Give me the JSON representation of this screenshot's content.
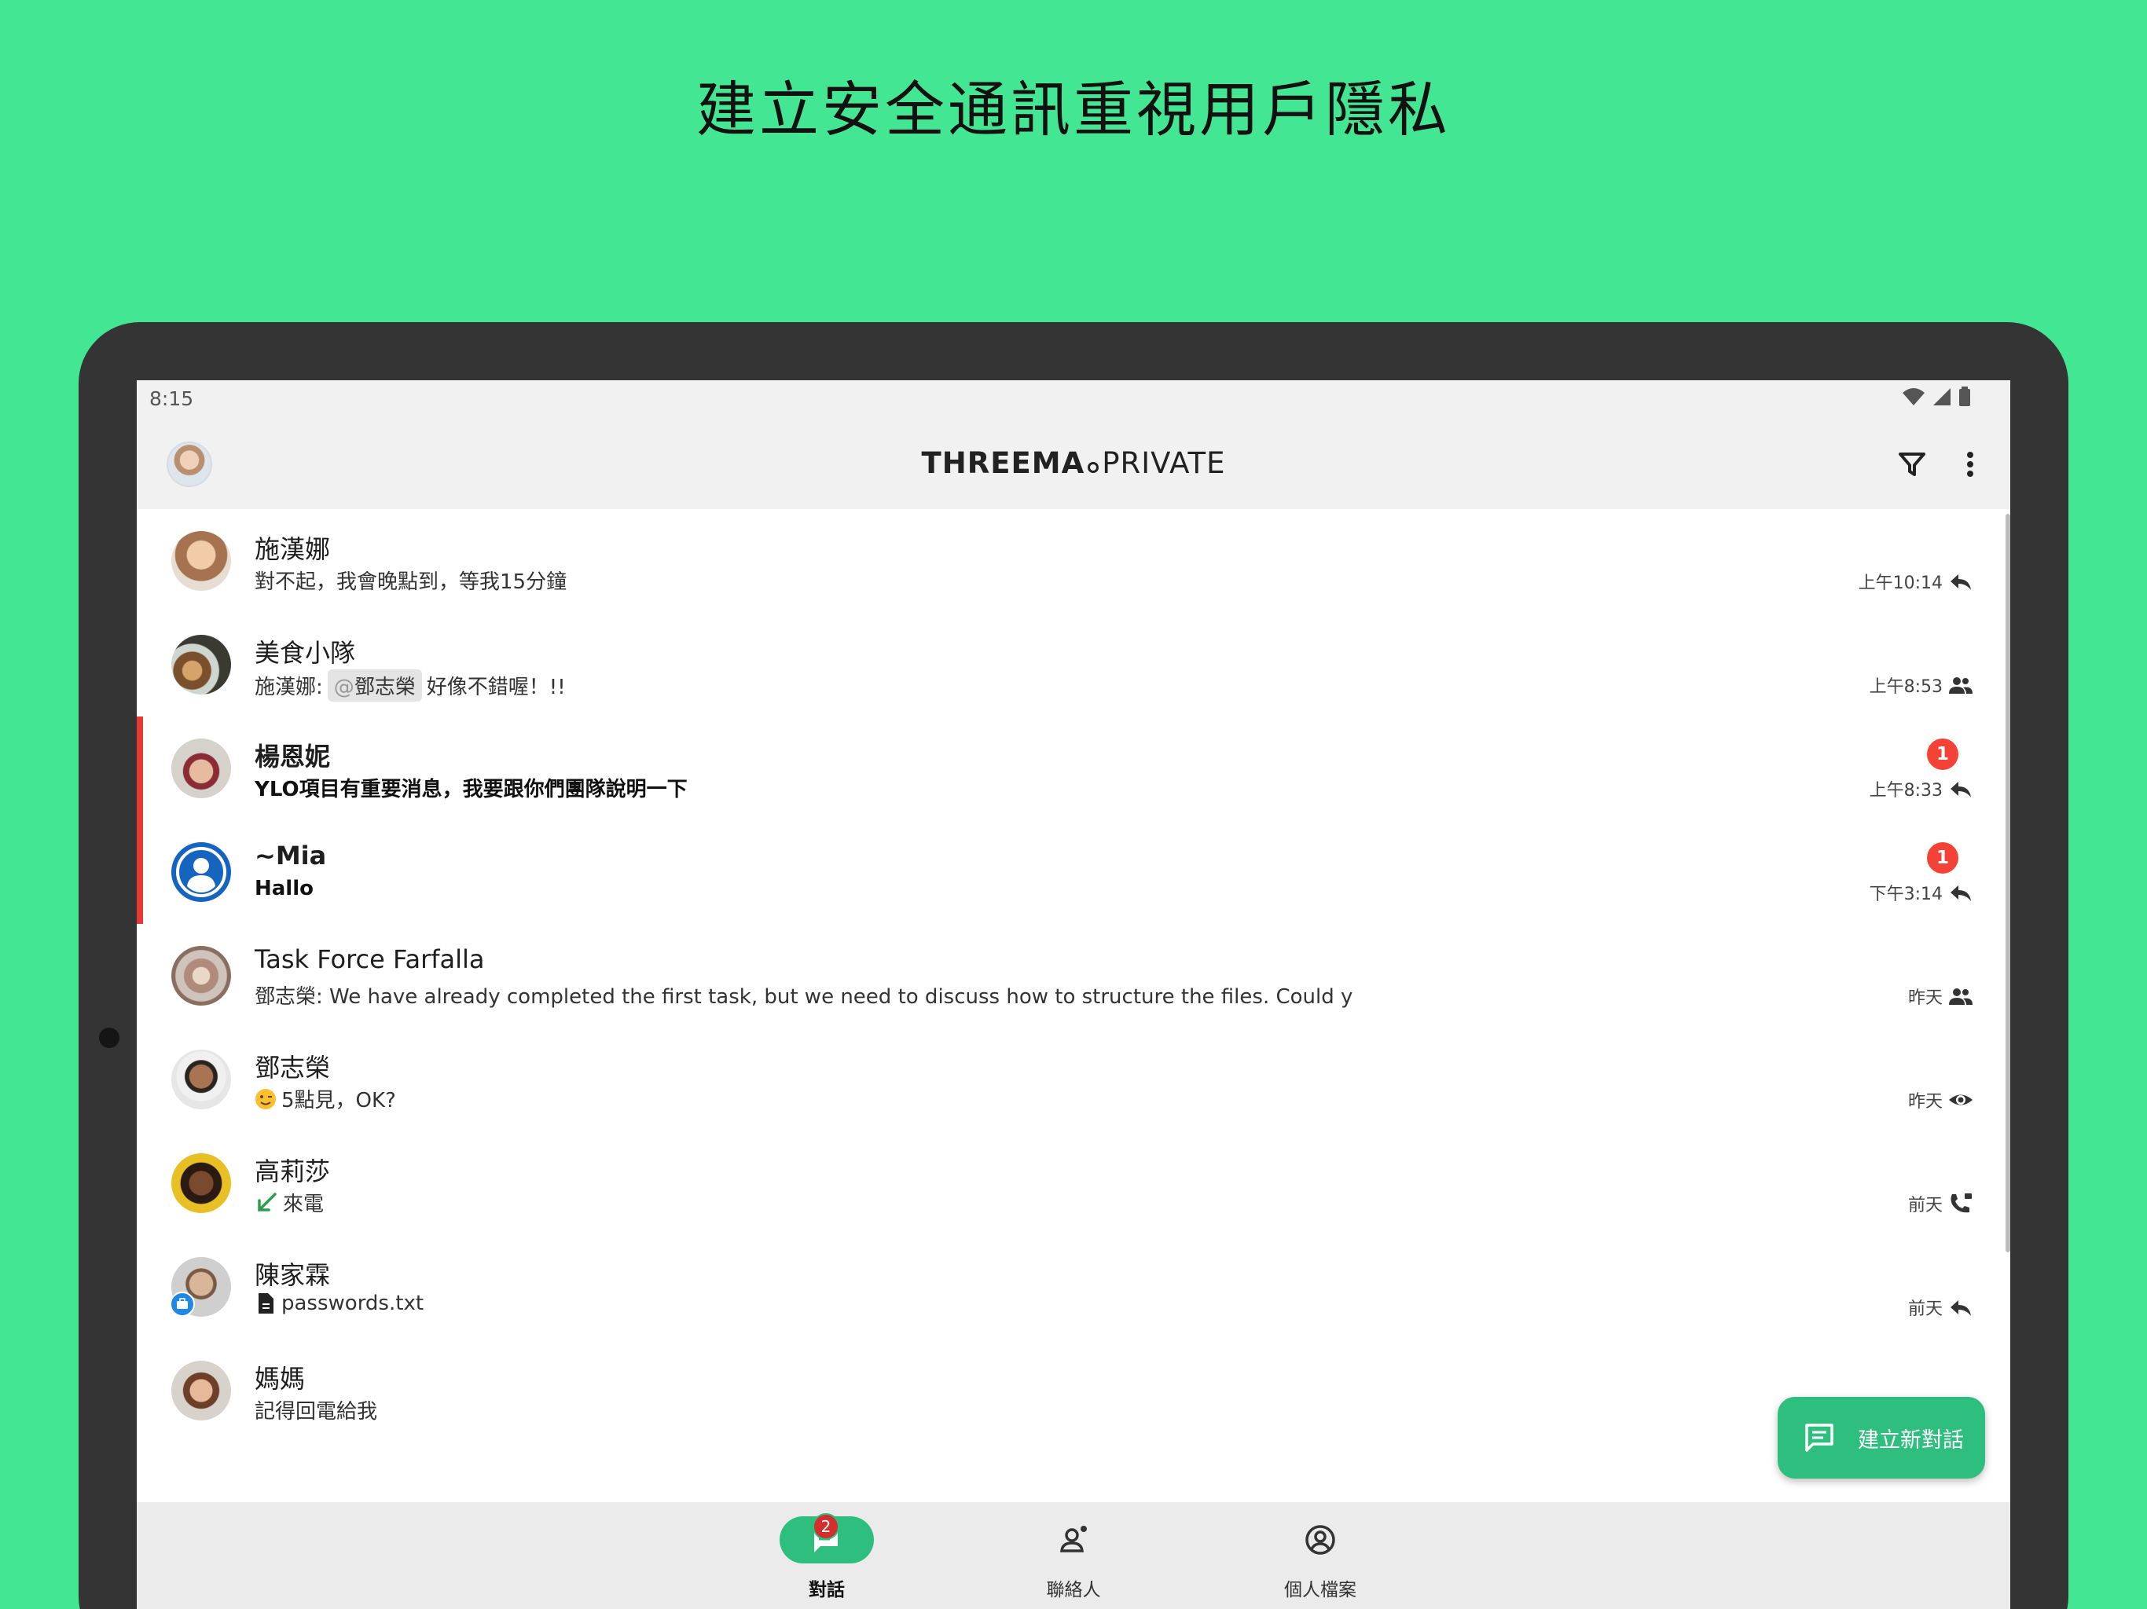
{
  "headline": "建立安全通訊重視用戶隱私",
  "status": {
    "time": "8:15"
  },
  "appbar": {
    "brand_bold": "THREEMA",
    "brand_thin": "PRIVATE"
  },
  "colors": {
    "accent": "#2ebf7f",
    "background": "#43e692",
    "unread_flag": "#e53935",
    "badge": "#f44336"
  },
  "conversations": [
    {
      "name": "施漢娜",
      "preview": "對不起，我會晚點到，等我15分鐘",
      "time": "上午10:14",
      "status_icon": "reply-icon",
      "unread": 0
    },
    {
      "name": "美食小隊",
      "preview_prefix": "施漢娜:",
      "mention_at": "@",
      "mention": "鄧志榮",
      "preview_suffix": "好像不錯喔！!!",
      "time": "上午8:53",
      "status_icon": "group-icon",
      "unread": 0
    },
    {
      "name": "楊恩妮",
      "preview": "YLO項目有重要消息，我要跟你們團隊說明一下",
      "time": "上午8:33",
      "status_icon": "reply-icon",
      "unread": 1,
      "unread_label": "1"
    },
    {
      "name": "~Mia",
      "preview": "Hallo",
      "time": "下午3:14",
      "status_icon": "reply-icon",
      "unread": 1,
      "unread_label": "1"
    },
    {
      "name": "Task Force Farfalla",
      "preview": "鄧志榮: We have already completed the first task, but we need to discuss how to structure the files. Could y",
      "time": "昨天",
      "status_icon": "group-icon",
      "unread": 0
    },
    {
      "name": "鄧志榮",
      "preview": "5點見，OK?",
      "preview_icon": "winking-face-icon",
      "time": "昨天",
      "status_icon": "eye-icon",
      "unread": 0
    },
    {
      "name": "高莉莎",
      "preview": "來電",
      "preview_icon": "incoming-call-arrow-icon",
      "time": "前天",
      "status_icon": "phone-icon",
      "unread": 0
    },
    {
      "name": "陳家霖",
      "preview": "passwords.txt",
      "preview_icon": "file-icon",
      "time": "前天",
      "status_icon": "reply-icon",
      "unread": 0
    },
    {
      "name": "媽媽",
      "preview": "記得回電給我",
      "time": "",
      "unread": 0
    }
  ],
  "fab": {
    "label": "建立新對話"
  },
  "bottom_nav": [
    {
      "label": "對話",
      "badge": "2",
      "icon": "chat-icon",
      "active": true
    },
    {
      "label": "聯絡人",
      "icon": "contacts-icon",
      "active": false
    },
    {
      "label": "個人檔案",
      "icon": "profile-icon",
      "active": false
    }
  ]
}
